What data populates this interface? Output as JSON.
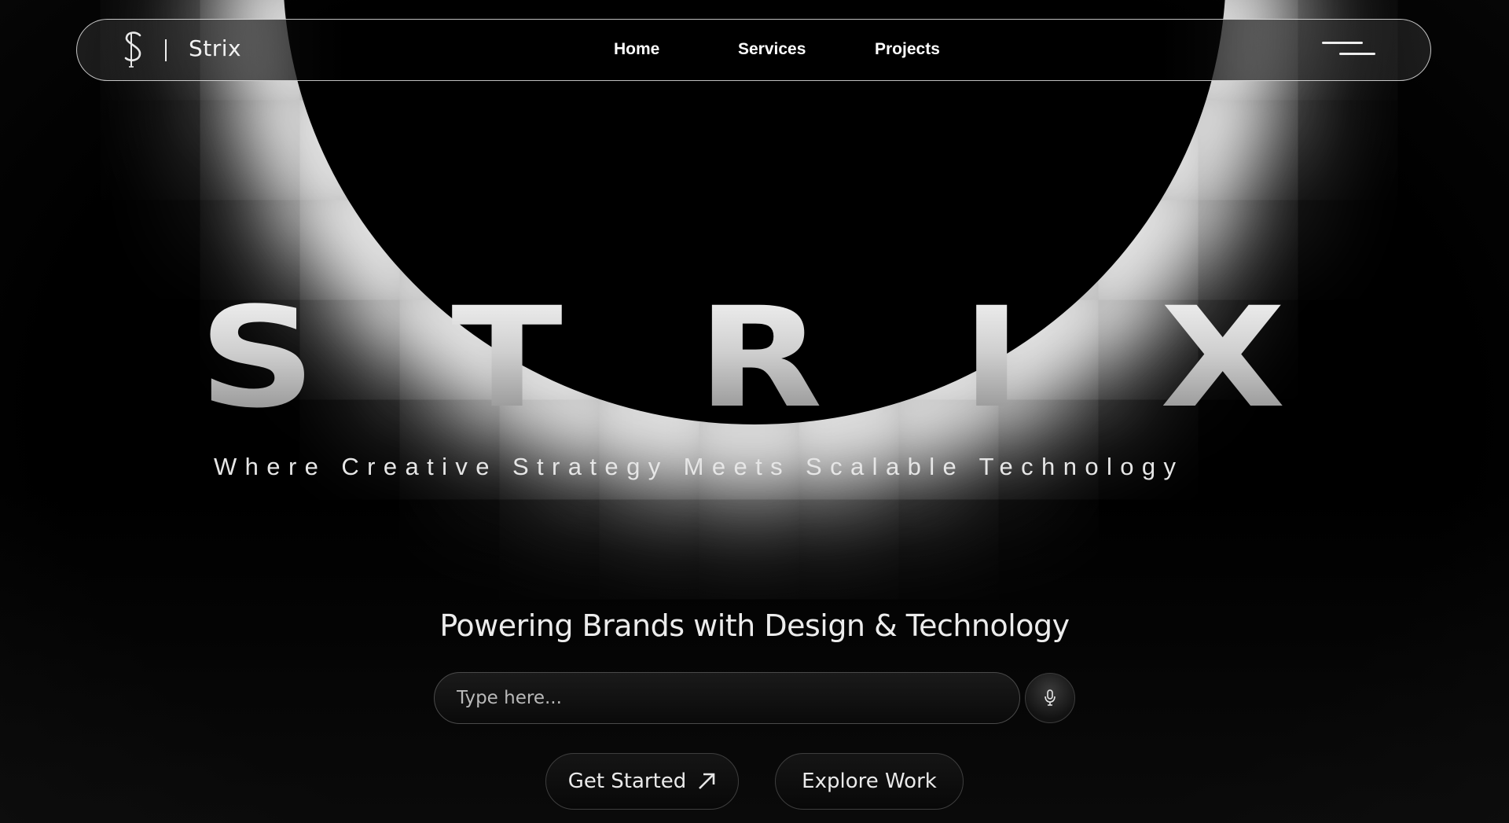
{
  "header": {
    "brand": "Strix",
    "nav": [
      {
        "label": "Home"
      },
      {
        "label": "Services"
      },
      {
        "label": "Projects"
      }
    ],
    "menu_icon": "hamburger-menu-icon"
  },
  "hero": {
    "title_letters": [
      "S",
      "T",
      "R",
      "I",
      "X"
    ],
    "tagline": "Where Creative Strategy Meets Scalable Technology",
    "subheading": "Powering Brands with Design & Technology"
  },
  "search": {
    "placeholder": "Type here...",
    "value": "",
    "mic_icon": "microphone-icon"
  },
  "actions": {
    "get_started": "Get Started",
    "get_started_icon": "arrow-up-right-icon",
    "explore_work": "Explore Work"
  },
  "colors": {
    "background": "#000000",
    "glow": "#ffffff",
    "text": "#ececec"
  }
}
